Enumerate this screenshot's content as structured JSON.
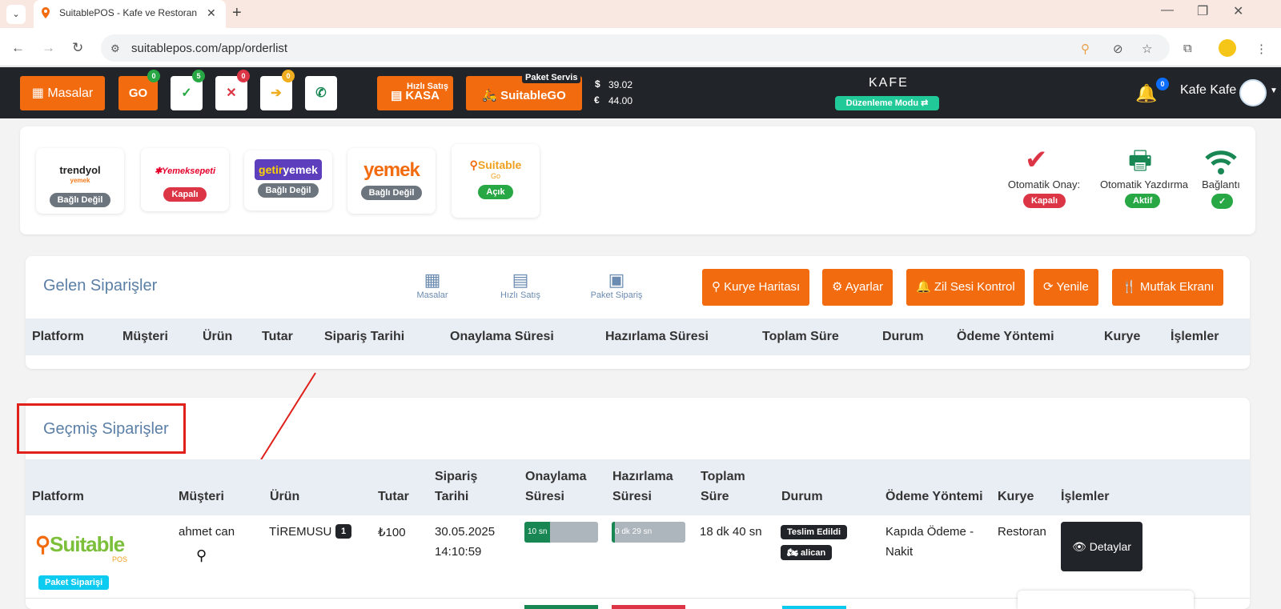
{
  "browser": {
    "tab_title": "SuitablePOS - Kafe ve Restoran",
    "url": "suitablepos.com/app/orderlist"
  },
  "header": {
    "masalar": "Masalar",
    "go": "GO",
    "go_count": "0",
    "check_count": "5",
    "cross_count": "0",
    "arrow_count": "0",
    "hizli_label": "Hızlı Satış",
    "kasa": "KASA",
    "paket_label": "Paket Servis",
    "suitablego": "SuitableGO",
    "usd": "39.02",
    "eur": "44.00",
    "usd_sym": "$",
    "eur_sym": "€",
    "store": "KAFE",
    "edit_mode": "Düzenleme Modu",
    "notif_count": "0",
    "user": "Kafe Kafe"
  },
  "platforms": [
    {
      "name": "trendyol yemek",
      "status": "Bağlı Değil",
      "color": "#6c757d"
    },
    {
      "name": "Yemeksepeti",
      "status": "Kapalı",
      "color": "#dc3545"
    },
    {
      "name": "getir yemek",
      "status": "Bağlı Değil",
      "color": "#6c757d"
    },
    {
      "name": "migros yemek",
      "status": "Bağlı Değil",
      "color": "#6c757d"
    },
    {
      "name": "Suitable Go",
      "status": "Açık",
      "color": "#28a745"
    }
  ],
  "status": {
    "auto_confirm": "Otomatik Onay:",
    "auto_confirm_val": "Kapalı",
    "auto_print": "Otomatik Yazdırma",
    "auto_print_val": "Aktif",
    "connection": "Bağlantı"
  },
  "incoming": {
    "title": "Gelen Siparişler",
    "quick": [
      "Masalar",
      "Hızlı Satış",
      "Paket Sipariş"
    ],
    "actions": [
      "Kurye Haritası",
      "Ayarlar",
      "Zil Sesi Kontrol",
      "Yenile",
      "Mutfak Ekranı"
    ],
    "columns": [
      "Platform",
      "Müşteri",
      "Ürün",
      "Tutar",
      "Sipariş Tarihi",
      "Onaylama Süresi",
      "Hazırlama Süresi",
      "Toplam Süre",
      "Durum",
      "Ödeme Yöntemi",
      "Kurye",
      "İşlemler"
    ]
  },
  "past": {
    "title": "Geçmiş Siparişler",
    "columns": {
      "platform": "Platform",
      "musteri": "Müşteri",
      "urun": "Ürün",
      "tutar": "Tutar",
      "siparis1": "Sipariş",
      "siparis2": "Tarihi",
      "onay1": "Onaylama",
      "onay2": "Süresi",
      "hazir1": "Hazırlama",
      "hazir2": "Süresi",
      "toplam1": "Toplam",
      "toplam2": "Süre",
      "durum": "Durum",
      "odeme": "Ödeme Yöntemi",
      "kurye": "Kurye",
      "islemler": "İşlemler"
    },
    "row": {
      "platform_logo": "Suitable",
      "platform_sub": "POS",
      "platform_tag": "Paket Siparişi",
      "customer": "ahmet can",
      "product": "TİREMUSU",
      "qty": "1",
      "amount": "₺100",
      "date": "30.05.2025",
      "time": "14:10:59",
      "confirm_time": "10 sn",
      "confirm_fill": 0.35,
      "prep_time": "0 dk 29 sn",
      "prep_fill": 0.04,
      "total": "18 dk 40 sn",
      "status": "Teslim Edildi",
      "courier_badge": "alican",
      "payment1": "Kapıda Ödeme -",
      "payment2": "Nakit",
      "courier": "Restoran",
      "details": "Detaylar"
    }
  }
}
